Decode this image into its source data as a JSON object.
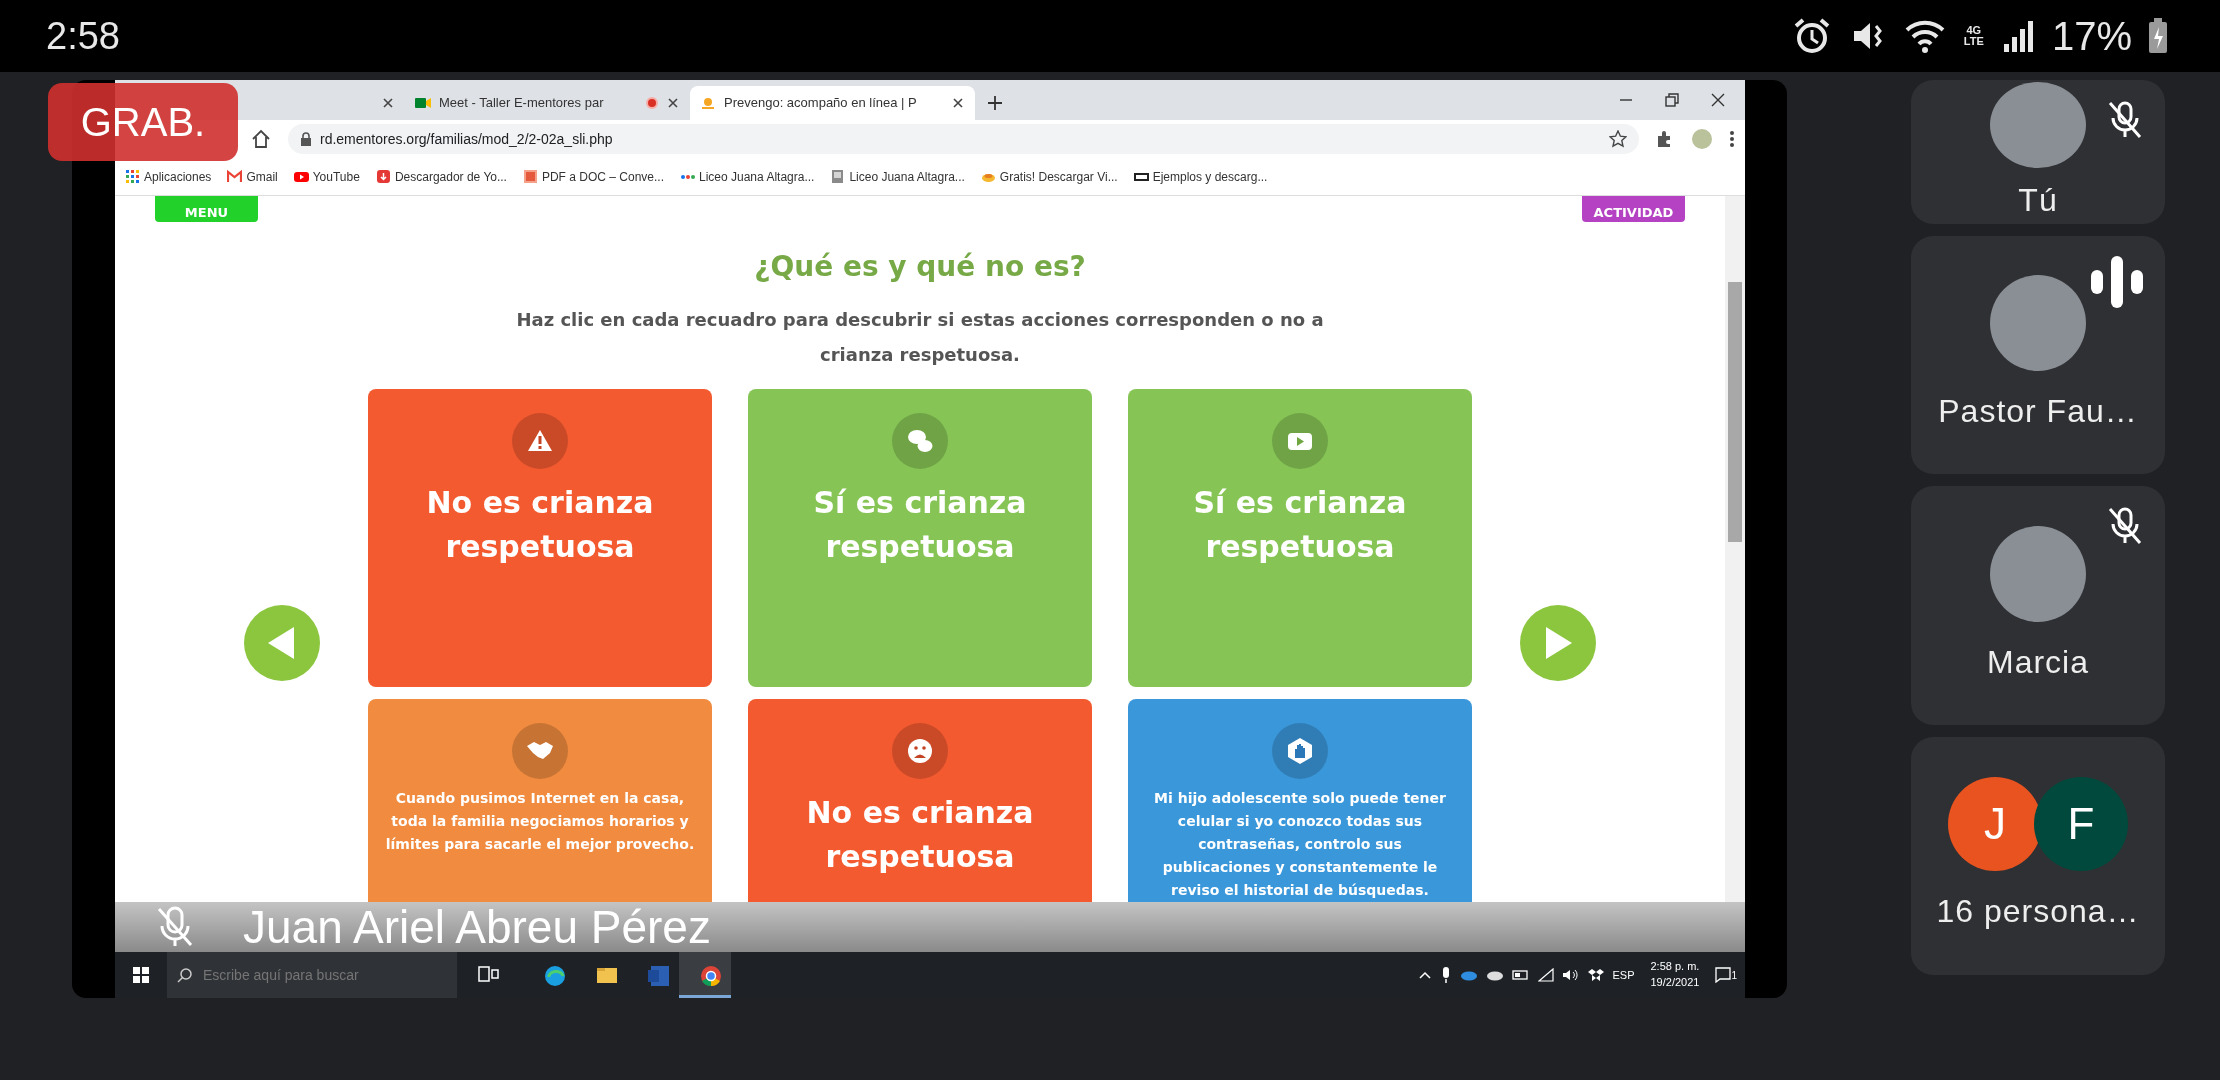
{
  "status_bar": {
    "time": "2:58",
    "network": "4G LTE",
    "battery": "17%"
  },
  "recording_badge": "GRAB.",
  "browser": {
    "tabs": [
      {
        "selected": false
      },
      {
        "label": "Meet - Taller E-mentores par",
        "selected": false,
        "recording": true
      },
      {
        "label": "Prevengo: acompaño en línea | P",
        "selected": true,
        "recording": false
      }
    ],
    "url": "rd.ementores.org/familias/mod_2/2-02a_sli.php",
    "bookmarks": [
      {
        "label": "Aplicaciones"
      },
      {
        "label": "Gmail"
      },
      {
        "label": "YouTube"
      },
      {
        "label": "Descargador de Yo..."
      },
      {
        "label": "PDF a DOC – Conve..."
      },
      {
        "label": "Liceo Juana Altagra..."
      },
      {
        "label": "Liceo Juana Altagra..."
      },
      {
        "label": "Gratis! Descargar Vi..."
      },
      {
        "label": "Ejemplos y descarg..."
      }
    ]
  },
  "page": {
    "back_button": "MENU",
    "next_button": "ACTIVIDAD",
    "title": "¿Qué es y qué no es?",
    "instructions": "Haz clic en cada recuadro para descubrir si estas acciones corresponden o no a crianza respetuosa.",
    "cards": [
      {
        "kind": "result",
        "text": "No es crianza respetuosa",
        "color": "#f35a30"
      },
      {
        "kind": "result",
        "text": "Sí es crianza respetuosa",
        "color": "#86c555"
      },
      {
        "kind": "result",
        "text": "Sí es crianza respetuosa",
        "color": "#86c555"
      },
      {
        "kind": "statement",
        "text": "Cuando pusimos Internet en la casa, toda la familia negociamos horarios y límites para sacarle el mejor provecho.",
        "color": "#f08b3f"
      },
      {
        "kind": "result",
        "text": "No es crianza respetuosa",
        "color": "#f35a30"
      },
      {
        "kind": "statement",
        "text": "Mi hijo adolescente solo puede tener celular si yo conozco todas sus contraseñas, controlo sus publicaciones y constantemente le reviso el historial de búsquedas.",
        "color": "#3a97da"
      }
    ]
  },
  "taskbar": {
    "search_placeholder": "Escribe aquí para buscar",
    "apps": [
      {
        "selected": false
      },
      {
        "selected": false
      },
      {
        "selected": false
      },
      {
        "selected": false
      },
      {
        "selected": true
      }
    ],
    "language": "ESP",
    "time": "2:58 p. m.",
    "date": "19/2/2021",
    "notifications": "1"
  },
  "presenter": {
    "name": "Juan Ariel Abreu Pérez",
    "muted": true
  },
  "participants": [
    {
      "kind": "person",
      "name": "Tú",
      "muted": true,
      "speaking": false
    },
    {
      "kind": "person",
      "name": "Pastor Fau…",
      "muted": false,
      "speaking": true
    },
    {
      "kind": "person",
      "name": "Marcia",
      "muted": true,
      "speaking": false
    },
    {
      "kind": "group",
      "name": "16 persona…",
      "initials": [
        {
          "letter": "J",
          "color": "#e8531f"
        },
        {
          "letter": "F",
          "color": "#00493c"
        }
      ]
    }
  ]
}
